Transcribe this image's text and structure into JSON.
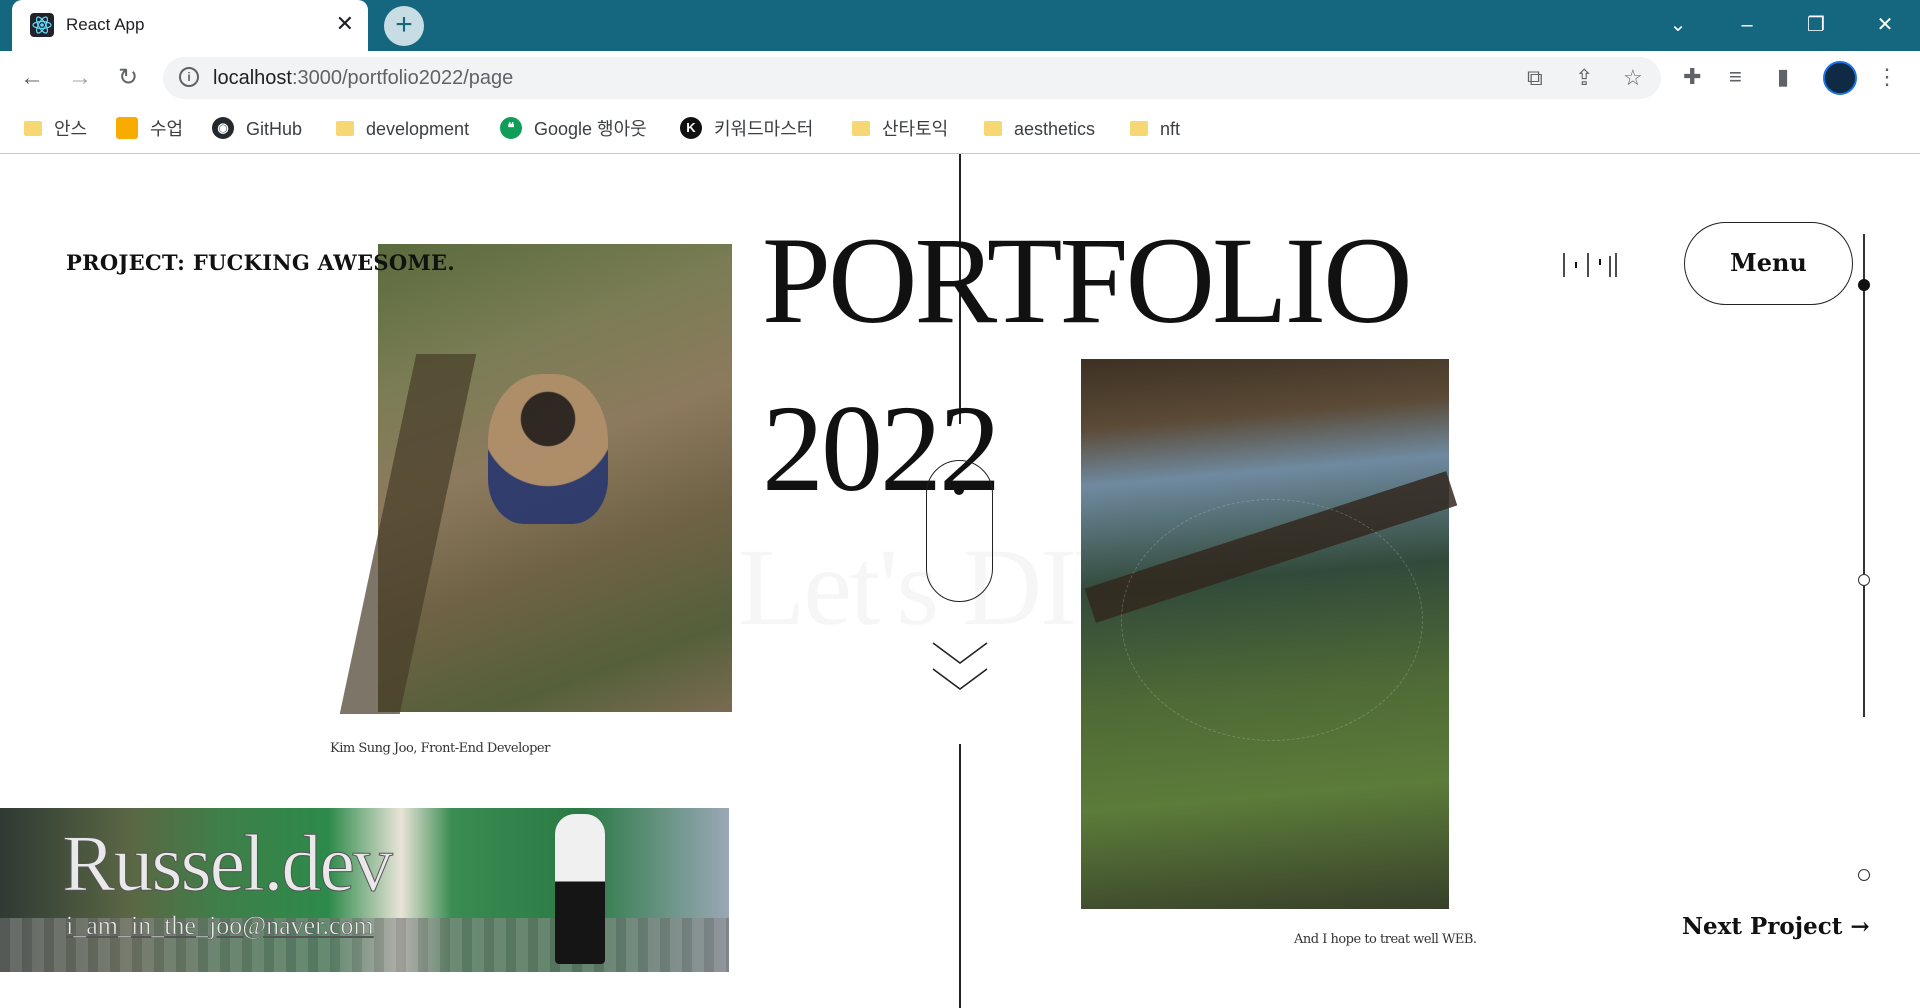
{
  "browser": {
    "tab_title": "React App",
    "tab_close": "✕",
    "new_tab": "+",
    "url_host": "localhost",
    "url_rest": ":3000/portfolio2022/page",
    "window_controls": {
      "minimize": "–",
      "restore": "❐",
      "close": "✕",
      "tab_search": "⌄"
    },
    "nav": {
      "back": "←",
      "forward": "→",
      "reload": "↻"
    },
    "bookmarks": [
      {
        "label": "안스",
        "icon": "folder-icon"
      },
      {
        "label": "수업",
        "icon": "classroom-icon"
      },
      {
        "label": "GitHub",
        "icon": "github-icon"
      },
      {
        "label": "development",
        "icon": "folder-icon"
      },
      {
        "label": "Google 행아웃",
        "icon": "hangouts-icon"
      },
      {
        "label": "키워드마스터",
        "icon": "k-icon"
      },
      {
        "label": "산타토익",
        "icon": "folder-icon"
      },
      {
        "label": "aesthetics",
        "icon": "folder-icon"
      },
      {
        "label": "nft",
        "icon": "folder-icon"
      }
    ],
    "colors": {
      "tabbar": "#14677f",
      "accent": "#1a73e8"
    }
  },
  "page": {
    "project_title": "PROJECT: FUCKING AWESOME.",
    "heading": "PORTFOLIO",
    "year": "2022",
    "watermark": "Let's DIY",
    "caption_left": "Kim Sung Joo, Front-End Developer",
    "caption_right": "And I hope to treat well WEB.",
    "menu_label": "Menu",
    "next_project": "Next Project →",
    "brand_name": "Russel.dev",
    "email": "i_am_in_the_joo@naver.com"
  }
}
